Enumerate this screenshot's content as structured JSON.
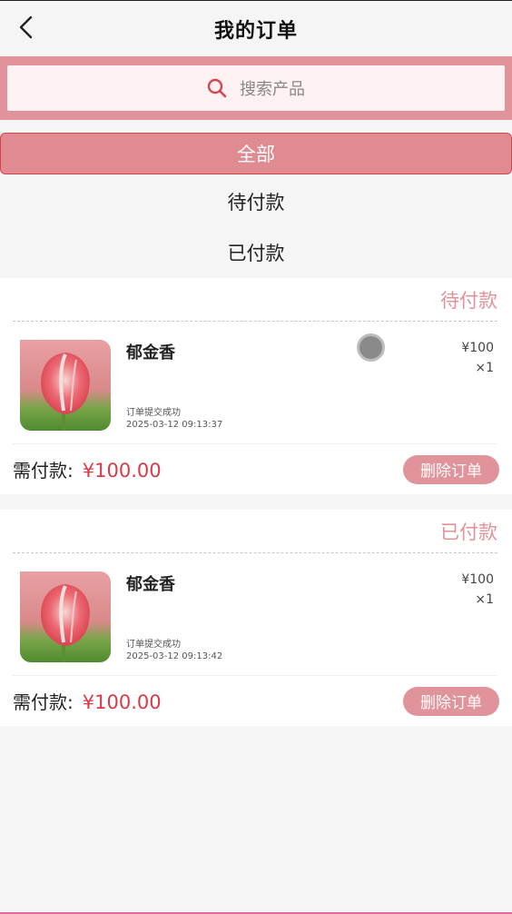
{
  "header": {
    "title": "我的订单"
  },
  "search": {
    "placeholder": "搜索产品"
  },
  "tabs": [
    {
      "label": "全部",
      "active": true
    },
    {
      "label": "待付款",
      "active": false
    },
    {
      "label": "已付款",
      "active": false
    }
  ],
  "orders": [
    {
      "status": "待付款",
      "product_name": "郁金香",
      "price": "¥100",
      "quantity": "×1",
      "note": "订单提交成功",
      "time": "2025-03-12 09:13:37",
      "pay_label": "需付款:",
      "pay_amount": "¥100.00",
      "delete_label": "删除订单"
    },
    {
      "status": "已付款",
      "product_name": "郁金香",
      "price": "¥100",
      "quantity": "×1",
      "note": "订单提交成功",
      "time": "2025-03-12 09:13:42",
      "pay_label": "需付款:",
      "pay_amount": "¥100.00",
      "delete_label": "删除订单"
    }
  ],
  "colors": {
    "accent": "#e0939a",
    "price": "#d93a4a",
    "background": "#f5f5f5"
  },
  "icons": [
    "back-arrow-icon",
    "search-icon",
    "tulip-image"
  ]
}
